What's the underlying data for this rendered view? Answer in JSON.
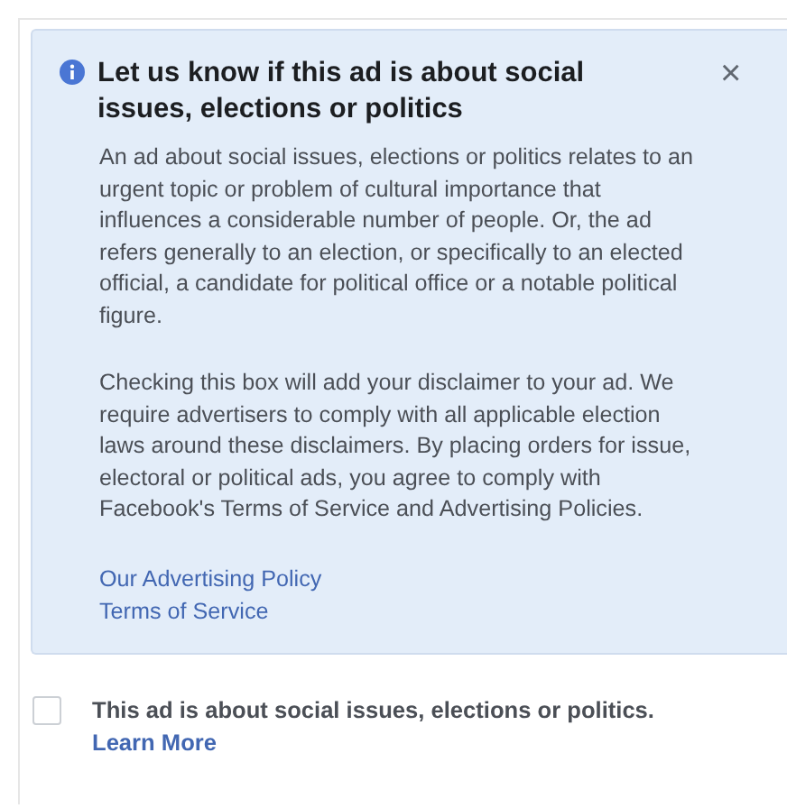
{
  "notice": {
    "title": "Let us know if this ad is about social issues, elections or politics",
    "close": "×",
    "paragraphs": [
      "An ad about social issues, elections or politics relates to an urgent topic or problem of cultural importance that influences a considerable number of people. Or, the ad refers generally to an election, or specifically to an elected official, a candidate for political office or a notable political figure.",
      "Checking this box will add your disclaimer to your ad. We require advertisers to comply with all applicable election laws around these disclaimers. By placing orders for issue, electoral or political ads, you agree to comply with Facebook's Terms of Service and Advertising Policies."
    ],
    "links": [
      "Our Advertising Policy",
      "Terms of Service"
    ]
  },
  "checkbox": {
    "label": "This ad is about social issues, elections or politics.",
    "checked": false,
    "link": "Learn More"
  }
}
